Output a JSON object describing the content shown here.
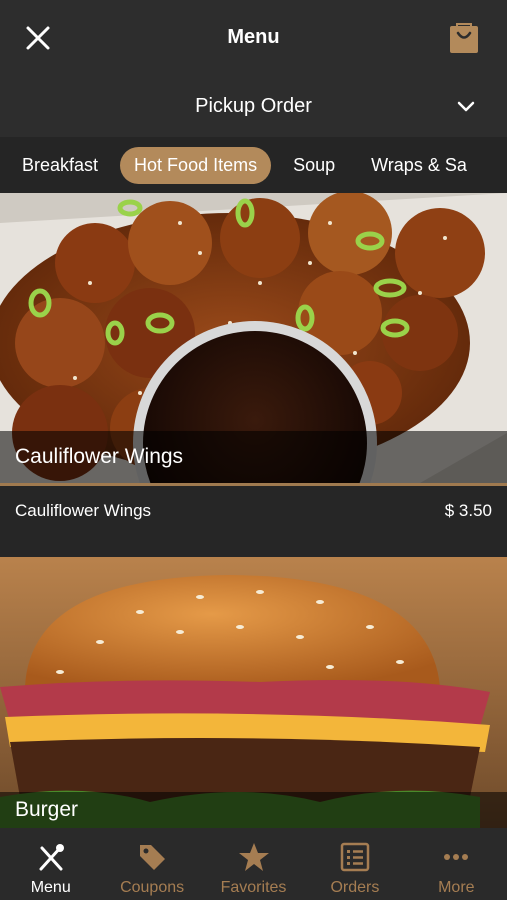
{
  "header": {
    "title": "Menu"
  },
  "icons": {
    "close": "close-icon",
    "bag": "shopping-bag-icon",
    "chevron": "chevron-down-icon"
  },
  "order": {
    "type_label": "Pickup Order"
  },
  "categories": [
    {
      "label": "Breakfast",
      "active": false
    },
    {
      "label": "Hot Food Items",
      "active": true
    },
    {
      "label": "Soup",
      "active": false
    },
    {
      "label": "Wraps & Sa",
      "active": false
    }
  ],
  "items": [
    {
      "caption": "Cauliflower Wings",
      "name": "Cauliflower Wings",
      "price": "$ 3.50"
    },
    {
      "caption": "Burger"
    }
  ],
  "tabs": [
    {
      "label": "Menu",
      "icon": "fork-knife-icon",
      "active": true
    },
    {
      "label": "Coupons",
      "icon": "tag-icon",
      "active": false
    },
    {
      "label": "Favorites",
      "icon": "star-icon",
      "active": false
    },
    {
      "label": "Orders",
      "icon": "list-icon",
      "active": false
    },
    {
      "label": "More",
      "icon": "more-dots-icon",
      "active": false
    }
  ],
  "colors": {
    "accent": "#b38a5b",
    "tab_inactive": "#a57d52",
    "bar": "#2d2d2d"
  }
}
